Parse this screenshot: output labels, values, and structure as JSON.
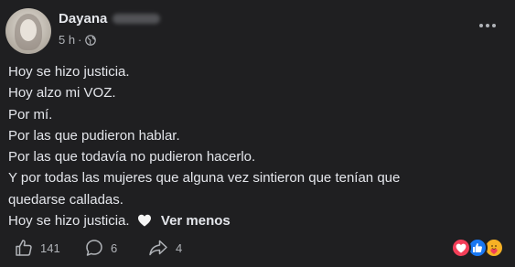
{
  "post": {
    "author": {
      "first_name": "Dayana",
      "last_name_obscured": true
    },
    "timestamp": "5 h",
    "meta_separator": "·",
    "privacy_icon": "globe-icon",
    "more_icon": "more-horizontal-icon",
    "text_lines": [
      "Hoy se hizo justicia.",
      "Hoy alzo mi VOZ.",
      "Por mí.",
      "Por las que pudieron hablar.",
      "Por las que todavía no pudieron hacerlo.",
      "Y por todas las mujeres que alguna vez sintieron que tenían que",
      "quedarse calladas.",
      "Hoy se hizo justicia."
    ],
    "inline_emoji": "white-heart-icon",
    "see_less_label": "Ver menos",
    "actions": {
      "like_count": "141",
      "comment_count": "6",
      "share_count": "4"
    },
    "reactions": [
      "love-reaction-icon",
      "like-reaction-icon",
      "care-reaction-icon"
    ],
    "colors": {
      "background": "#1f1f21",
      "text_primary": "#e4e6eb",
      "text_secondary": "#b0b3b8",
      "love": "#f33e58",
      "like": "#1877f2",
      "care": "#f7b125"
    }
  }
}
